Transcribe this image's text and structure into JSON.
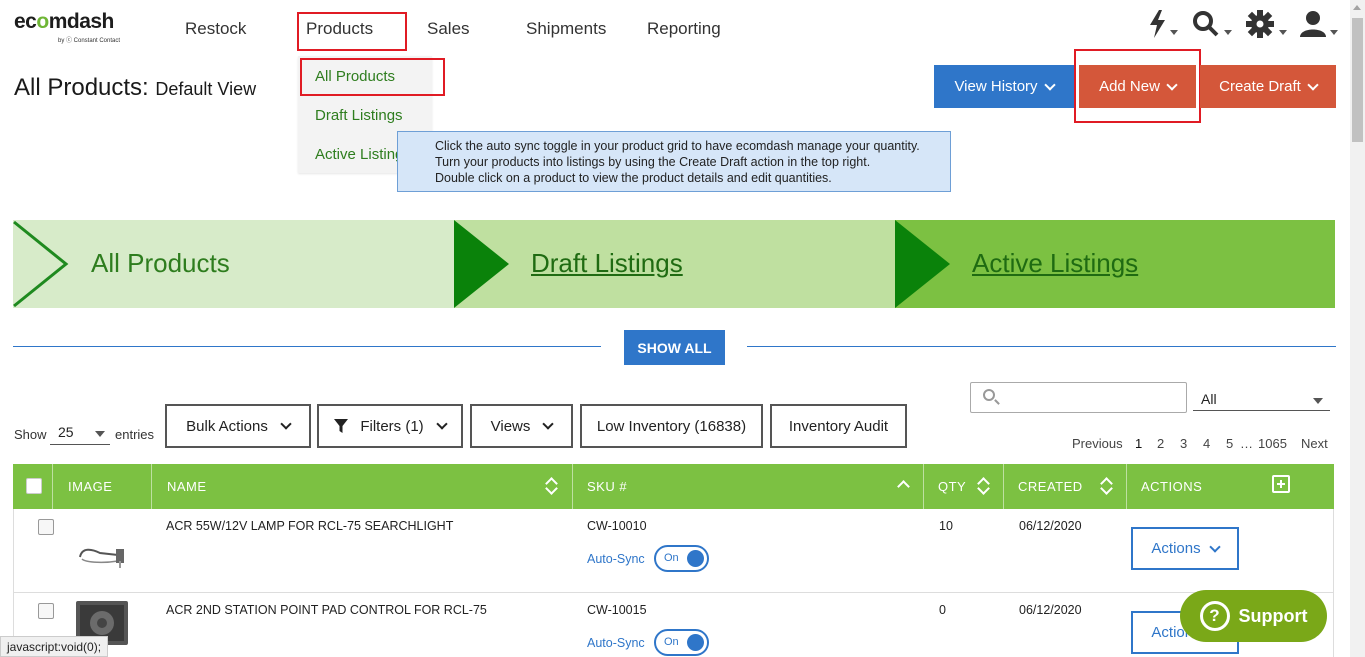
{
  "logo": {
    "word_a": "ec",
    "word_b": "o",
    "word_c": "mdash",
    "sub": "by ⓒ Constant Contact"
  },
  "nav": {
    "items": [
      {
        "label": "Restock"
      },
      {
        "label": "Products"
      },
      {
        "label": "Sales"
      },
      {
        "label": "Shipments"
      },
      {
        "label": "Reporting"
      }
    ],
    "icons": [
      "bolt-icon",
      "search-icon",
      "gear-icon",
      "user-icon"
    ]
  },
  "dropdown": {
    "items": [
      {
        "label": "All Products"
      },
      {
        "label": "Draft Listings"
      },
      {
        "label": "Active Listings"
      }
    ]
  },
  "page": {
    "title": "All Products:",
    "subtitle": "Default View"
  },
  "buttons": {
    "view_history": "View History",
    "add_new": "Add New",
    "create_draft": "Create Draft"
  },
  "info": {
    "line1": "Click the auto sync toggle in your product grid to have ecomdash manage your quantity.",
    "line2": "Turn your products into listings by using the Create Draft action in the top right.",
    "line3": "Double click on a product to view the product details and edit quantities."
  },
  "banner": {
    "seg1": "All Products",
    "seg2": "Draft Listings",
    "seg3": "Active Listings"
  },
  "show_all": "SHOW ALL",
  "controls": {
    "show": "Show",
    "entries_value": "25",
    "entries": "entries",
    "bulk_actions": "Bulk Actions",
    "filters": "Filters (1)",
    "views": "Views",
    "low_inventory": "Low Inventory (16838)",
    "inventory_audit": "Inventory Audit",
    "search_placeholder": "",
    "scope_value": "All"
  },
  "pager": {
    "previous": "Previous",
    "pages": [
      "1",
      "2",
      "3",
      "4",
      "5"
    ],
    "ellipsis": "…",
    "last": "1065",
    "next": "Next"
  },
  "table": {
    "headers": {
      "image": "IMAGE",
      "name": "NAME",
      "sku": "SKU #",
      "qty": "QTY",
      "created": "CREATED",
      "actions": "ACTIONS"
    },
    "rows": [
      {
        "name": "ACR 55W/12V LAMP FOR RCL-75 SEARCHLIGHT",
        "sku": "CW-10010",
        "autosync": "Auto-Sync",
        "toggle": "On",
        "qty": "10",
        "created": "06/12/2020",
        "actions": "Actions"
      },
      {
        "name": "ACR 2ND STATION POINT PAD CONTROL FOR RCL-75",
        "sku": "CW-10015",
        "autosync": "Auto-Sync",
        "toggle": "On",
        "qty": "0",
        "created": "06/12/2020",
        "actions": "Actions"
      }
    ]
  },
  "support": "Support",
  "statusbar": "javascript:void(0);",
  "colors": {
    "green": "#7cc142",
    "blue": "#2f76c9",
    "orange": "#d4573a",
    "highlight_red": "#e01b24",
    "support_green": "#7aa818"
  }
}
